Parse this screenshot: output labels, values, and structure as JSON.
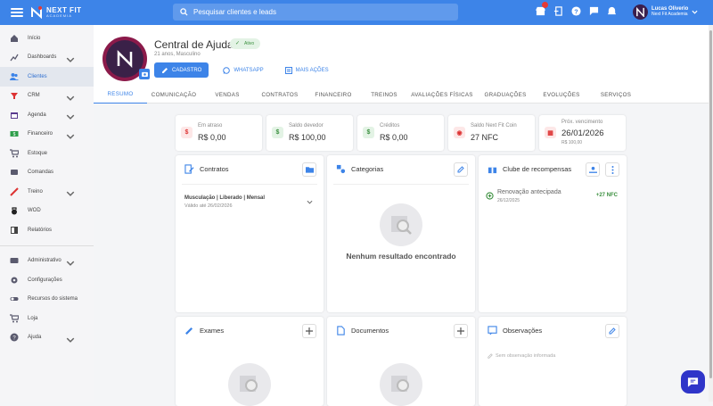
{
  "topbar": {
    "logo_text": "NEXT FIT",
    "logo_sub": "ACADEMIA",
    "search_placeholder": "Pesquisar clientes e leads",
    "user_name": "Lucas Oliverio",
    "user_org": "Next Fit Academia"
  },
  "sidebar": {
    "items": [
      {
        "label": "Início",
        "icon": "home-icon"
      },
      {
        "label": "Dashboards",
        "icon": "chart-icon"
      },
      {
        "label": "Clientes",
        "icon": "users-icon"
      },
      {
        "label": "CRM",
        "icon": "crm-icon"
      },
      {
        "label": "Agenda",
        "icon": "calendar-icon"
      },
      {
        "label": "Financeiro",
        "icon": "money-icon"
      },
      {
        "label": "Estoque",
        "icon": "cart-icon"
      },
      {
        "label": "Comandas",
        "icon": "receipt-icon"
      },
      {
        "label": "Treino",
        "icon": "dumbbell-icon"
      },
      {
        "label": "WOD",
        "icon": "kettlebell-icon"
      },
      {
        "label": "Relatórios",
        "icon": "report-icon"
      }
    ],
    "bottom_items": [
      {
        "label": "Administrativo",
        "icon": "admin-icon"
      },
      {
        "label": "Configurações",
        "icon": "gear-icon"
      },
      {
        "label": "Recursos do sistema",
        "icon": "toggle-icon"
      },
      {
        "label": "Loja",
        "icon": "cart-icon"
      },
      {
        "label": "Ajuda",
        "icon": "help-icon"
      }
    ]
  },
  "profile": {
    "name": "Central de Ajuda",
    "status": "Ativo",
    "meta": "21 anos, Masculino",
    "btn_cadastro": "CADASTRO",
    "btn_whatsapp": "WHATSAPP",
    "btn_mais": "MAIS AÇÕES"
  },
  "tabs": [
    "RESUMO",
    "COMUNICAÇÃO",
    "VENDAS",
    "CONTRATOS",
    "FINANCEIRO",
    "TREINOS",
    "AVALIAÇÕES FÍSICAS",
    "GRADUAÇÕES",
    "EVOLUÇÕES",
    "SERVIÇOS"
  ],
  "stats": [
    {
      "label": "Em atraso",
      "value": "R$ 0,00",
      "sub": ""
    },
    {
      "label": "Saldo devedor",
      "value": "R$ 100,00",
      "sub": ""
    },
    {
      "label": "Créditos",
      "value": "R$ 0,00",
      "sub": ""
    },
    {
      "label": "Saldo Next Fit Coin",
      "value": "27 NFC",
      "sub": ""
    },
    {
      "label": "Próx. vencimento",
      "value": "26/01/2026",
      "sub": "R$ 100,00"
    }
  ],
  "contratos": {
    "title": "Contratos",
    "item_title": "Musculação | Liberado | Mensal",
    "item_sub": "Válido até 26/02/2026"
  },
  "categorias": {
    "title": "Categorias",
    "empty": "Nenhum resultado encontrado"
  },
  "clube": {
    "title": "Clube de recompensas",
    "item_title": "Renovação antecipada",
    "item_date": "26/12/2025",
    "item_value": "+27 NFC"
  },
  "exames": {
    "title": "Exames"
  },
  "documentos": {
    "title": "Documentos"
  },
  "observacoes": {
    "title": "Observações",
    "empty": "Sem observação informada"
  },
  "colors": {
    "primary": "#3d84e8",
    "active_green": "#3a8f3e",
    "chat": "#2f35c9"
  }
}
